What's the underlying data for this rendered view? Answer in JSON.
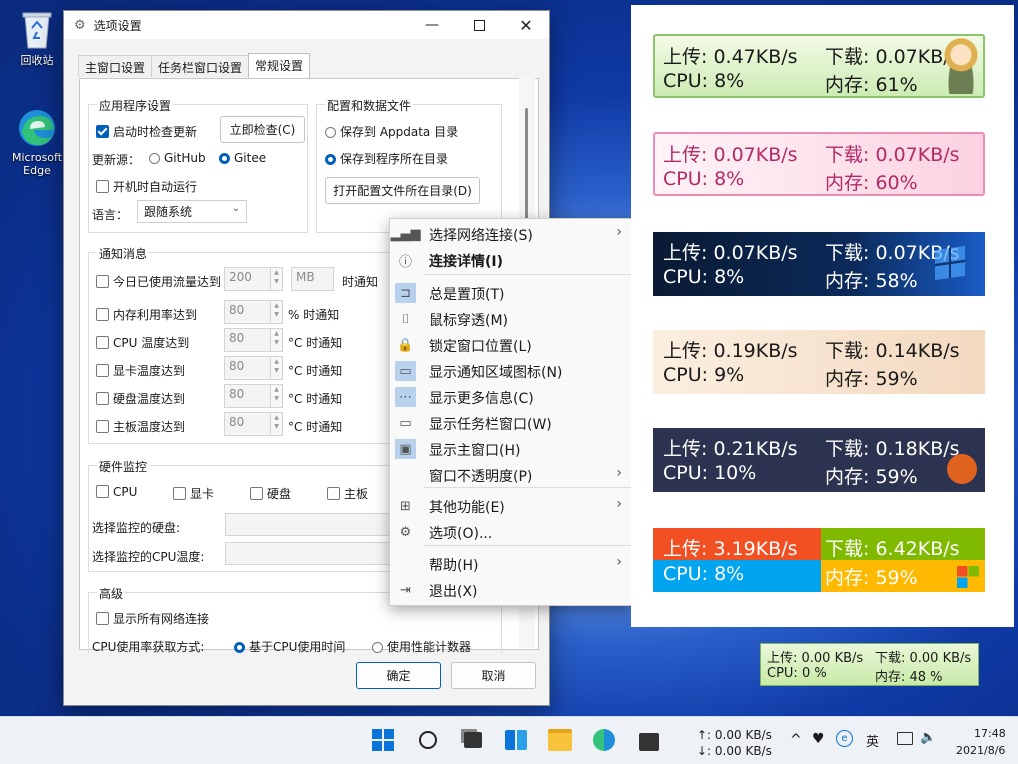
{
  "desktop": {
    "recycle_bin": "回收站",
    "edge": "Microsoft Edge"
  },
  "dialog": {
    "title": "选项设置",
    "tabs": [
      "主窗口设置",
      "任务栏窗口设置",
      "常规设置"
    ],
    "app_settings": {
      "title": "应用程序设置",
      "check_updates": "启动时检查更新",
      "check_now": "立即检查(C)",
      "update_source": "更新源：",
      "github": "GitHub",
      "gitee": "Gitee",
      "autorun": "开机时自动运行",
      "language_label": "语言：",
      "language_value": "跟随系统"
    },
    "config": {
      "title": "配置和数据文件",
      "save_appdata": "保存到 Appdata 目录",
      "save_program": "保存到程序所在目录",
      "open_dir": "打开配置文件所在目录(D)"
    },
    "notify": {
      "title": "通知消息",
      "traffic": "今日已使用流量达到",
      "traffic_value": "200",
      "traffic_unit": "MB",
      "traffic_suffix": "时通知",
      "items": [
        {
          "label": "内存利用率达到",
          "value": "80",
          "suffix": "% 时通知"
        },
        {
          "label": "CPU 温度达到",
          "value": "80",
          "suffix": "°C 时通知"
        },
        {
          "label": "显卡温度达到",
          "value": "80",
          "suffix": "°C 时通知"
        },
        {
          "label": "硬盘温度达到",
          "value": "80",
          "suffix": "°C 时通知"
        },
        {
          "label": "主板温度达到",
          "value": "80",
          "suffix": "°C 时通知"
        }
      ]
    },
    "hardware": {
      "title": "硬件监控",
      "cpu": "CPU",
      "gpu": "显卡",
      "disk": "硬盘",
      "board": "主板",
      "sel_disk": "选择监控的硬盘:",
      "sel_cpu_temp": "选择监控的CPU温度:"
    },
    "advanced": {
      "title": "高级",
      "show_all_net": "显示所有网络连接",
      "cpu_method": "CPU使用率获取方式:",
      "by_time": "基于CPU使用时间",
      "by_counter": "使用性能计数器"
    },
    "ok": "确定",
    "cancel": "取消"
  },
  "menu": {
    "items": [
      {
        "label": "选择网络连接(S)",
        "icon": "signal-bars-icon",
        "arrow": true
      },
      {
        "label": "连接详情(I)",
        "icon": "info-icon",
        "bold": true
      },
      {
        "label": "总是置顶(T)",
        "icon": "pin-icon",
        "checked": true
      },
      {
        "label": "鼠标穿透(M)",
        "icon": "mouse-icon"
      },
      {
        "label": "锁定窗口位置(L)",
        "icon": "lock-icon"
      },
      {
        "label": "显示通知区域图标(N)",
        "icon": "tray-icon",
        "checked": true
      },
      {
        "label": "显示更多信息(C)",
        "icon": "more-icon",
        "checked": true
      },
      {
        "label": "显示任务栏窗口(W)",
        "icon": "taskbar-window-icon"
      },
      {
        "label": "显示主窗口(H)",
        "icon": "main-window-icon",
        "checked": true
      },
      {
        "label": "窗口不透明度(P)",
        "arrow": true
      },
      {
        "label": "其他功能(E)",
        "icon": "apps-grid-icon",
        "arrow": true
      },
      {
        "label": "选项(O)...",
        "icon": "gear-icon"
      },
      {
        "label": "帮助(H)",
        "arrow": true
      },
      {
        "label": "退出(X)",
        "icon": "exit-icon"
      }
    ]
  },
  "skins": [
    {
      "up": "上传: 0.47KB/s",
      "down": "下载: 0.07KB/s",
      "cpu": "CPU: 8%",
      "mem": "内存: 61%"
    },
    {
      "up": "上传: 0.07KB/s",
      "down": "下载: 0.07KB/s",
      "cpu": "CPU: 8%",
      "mem": "内存: 60%"
    },
    {
      "up": "上传: 0.07KB/s",
      "down": "下载: 0.07KB/s",
      "cpu": "CPU: 8%",
      "mem": "内存: 58%"
    },
    {
      "up": "上传: 0.19KB/s",
      "down": "下载: 0.14KB/s",
      "cpu": "CPU: 9%",
      "mem": "内存: 59%"
    },
    {
      "up": "上传: 0.21KB/s",
      "down": "下载: 0.18KB/s",
      "cpu": "CPU: 10%",
      "mem": "内存: 59%"
    },
    {
      "up": "上传: 3.19KB/s",
      "down": "下载: 6.42KB/s",
      "cpu": "CPU: 8%",
      "mem": "内存: 59%"
    }
  ],
  "mini": {
    "up": "上传: 0.00 KB/s",
    "down": "下载: 0.00 KB/s",
    "cpu": "CPU: 0 %",
    "mem": "内存: 48 %"
  },
  "taskbar": {
    "net_up": "↑: 0.00 KB/s",
    "net_down": "↓: 0.00 KB/s",
    "ime": "英",
    "time": "17:48",
    "date": "2021/8/6"
  }
}
